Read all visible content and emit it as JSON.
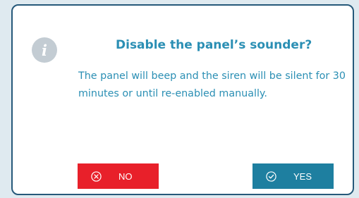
{
  "dialog": {
    "title": "Disable the panel’s sounder?",
    "message": "The panel will beep and the siren will be silent for 30 minutes or until re-enabled manually.",
    "info_icon_glyph": "i"
  },
  "buttons": {
    "no": {
      "label": "NO",
      "icon": "circle-x-icon",
      "color": "#e8202a"
    },
    "yes": {
      "label": "YES",
      "icon": "circle-check-icon",
      "color": "#1e7fa0"
    }
  },
  "colors": {
    "background": "#dfeaf0",
    "dialog_border": "#26597a",
    "text_accent": "#2b8fb4",
    "info_icon": "#c3ccd3"
  }
}
